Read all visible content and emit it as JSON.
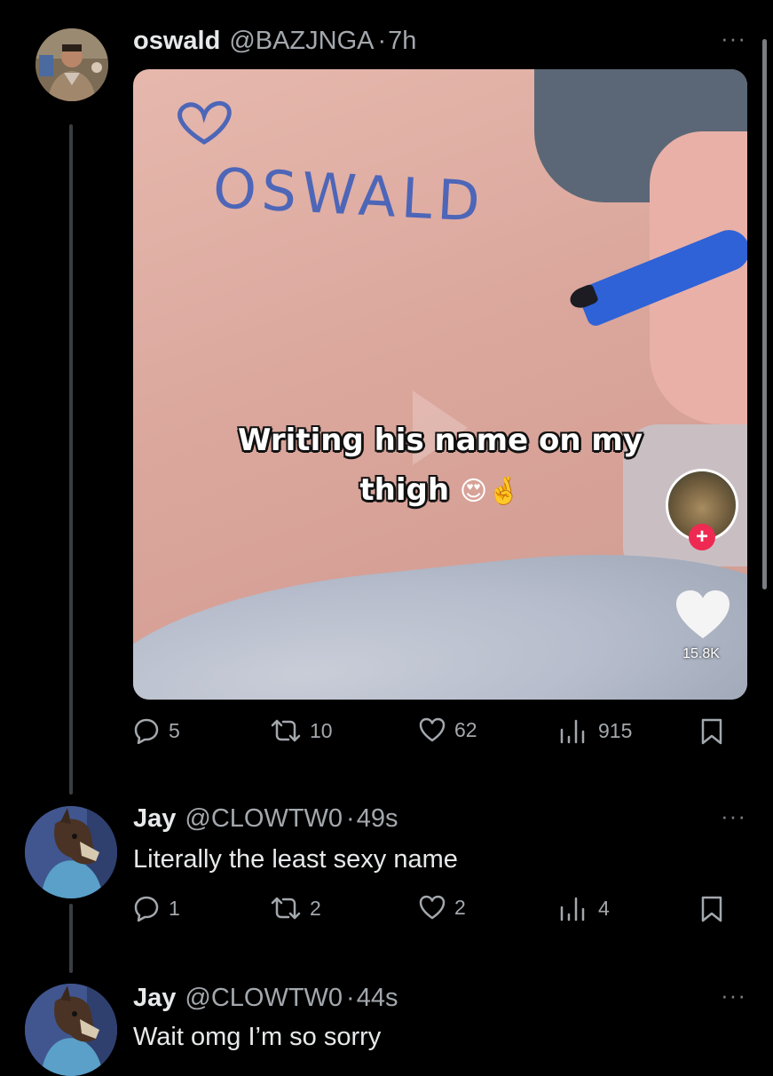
{
  "main_post": {
    "name": "oswald",
    "handle": "@BAZJNGA",
    "separator": "·",
    "time": "7h",
    "media": {
      "written_name": "OSWALD",
      "caption_line1": "Writing his name on my",
      "caption_line2": "thigh",
      "caption_emojis": "😍🤞",
      "follow_symbol": "+",
      "like_count": "15.8K"
    },
    "stats": {
      "replies": "5",
      "reposts": "10",
      "likes": "62",
      "views": "915"
    }
  },
  "replies": [
    {
      "name": "Jay",
      "handle": "@CLOWTW0",
      "separator": "·",
      "time": "49s",
      "text": "Literally the least sexy name",
      "stats": {
        "replies": "1",
        "reposts": "2",
        "likes": "2",
        "views": "4"
      }
    },
    {
      "name": "Jay",
      "handle": "@CLOWTW0",
      "separator": "·",
      "time": "44s",
      "text": "Wait omg I’m so sorry"
    }
  ],
  "ui": {
    "more_glyph": "···"
  },
  "icons": {
    "reply": "speech-bubble-icon",
    "repost": "repost-arrows-icon",
    "like": "heart-icon",
    "views": "bar-chart-icon",
    "bookmark": "bookmark-icon",
    "more": "ellipsis-icon"
  },
  "colors": {
    "background": "#000000",
    "text": "#e7e9ea",
    "muted": "#a3a8ad",
    "tiktok_red": "#ee2a52"
  }
}
